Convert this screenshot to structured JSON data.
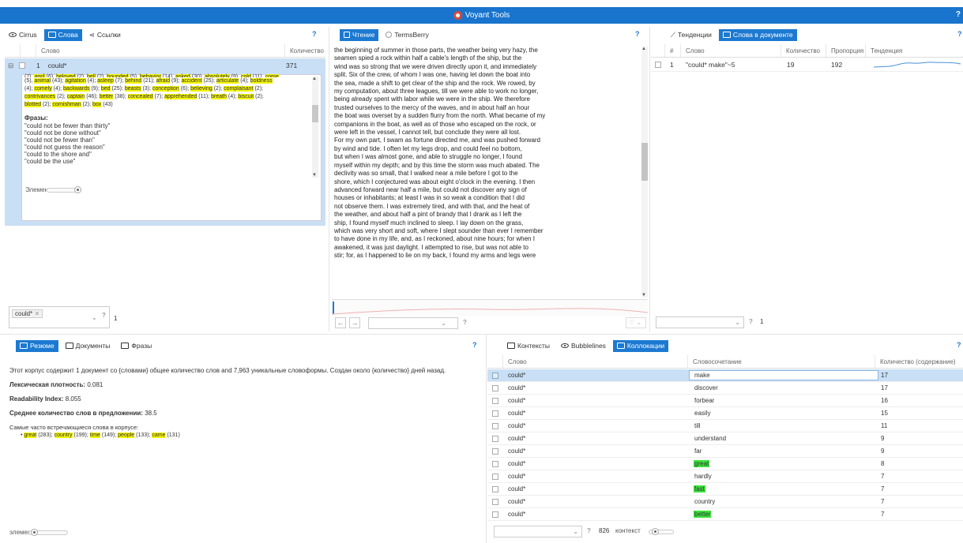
{
  "app": {
    "title": "Voyant Tools",
    "help": "?"
  },
  "left_panel": {
    "tabs": [
      {
        "label": "Cirrus",
        "icon": "eye-icon"
      },
      {
        "label": "Слова",
        "icon": "grid-icon"
      },
      {
        "label": "Ссылки",
        "icon": "network-icon"
      }
    ],
    "columns": {
      "word": "Слово",
      "count": "Количество"
    },
    "row": {
      "index": "1",
      "word": "could*",
      "count": "371"
    },
    "phrases_title": "Фразы:",
    "phrases": [
      "\"could not be fewer than thirty\"",
      "\"could not be done without\"",
      "\"could not be fewer than\"",
      "\"could not guess the reason\"",
      "\"could to the shore and\"",
      "\"could be the use\""
    ],
    "elements_label": "Элемен",
    "query_chip": "could*",
    "results_count": "1"
  },
  "reader_panel": {
    "tabs": [
      {
        "label": "Чтение",
        "icon": "document-icon"
      },
      {
        "label": "TermsBerry",
        "icon": "radio-icon"
      }
    ],
    "lines": [
      "the beginning of summer in those parts, the weather being very hazy, the",
      "seamen spied a rock within half a cable's length of the ship, but the",
      "wind was so strong that we were driven directly upon it, and immediately",
      "split. Six of the crew, of whom I was one, having let down the boat into",
      "the sea, made a shift to get clear of the ship and the rock. We rowed, by",
      "my computation, about three leagues, till we were able to work no longer,",
      "being already spent with labor while we were in the ship. We therefore",
      "trusted ourselves to the mercy of the waves, and in about half an hour",
      "the boat was overset by a sudden flurry from the north. What became of my",
      "companions in the boat, as well as of those who escaped on the rock, or",
      "were left in the vessel, I cannot tell, but conclude they were all lost.",
      "For my own part, I swam as fortune directed me, and was pushed forward",
      "by wind and tide. I often let my legs drop, and could feel no bottom,",
      "but when I was almost gone, and able to struggle no longer, I found",
      "myself within my depth; and by this time the storm was much abated. The",
      "declivity was so small, that I walked near a mile before I got to the",
      "shore, which I conjectured was about eight o'clock in the evening. I then",
      "advanced forward near half a mile, but could not discover any sign of",
      "houses or inhabitants; at least I was in so weak a condition that I did",
      "not observe them. I was extremely tired, and with that, and the heat of",
      "the weather, and about half a pint of brandy that I drank as I left the",
      "ship, I found myself much inclined to sleep. I lay down on the grass,",
      "which was very short and soft, where I slept sounder than ever I remember",
      "to have done in my life, and, as I reckoned, about nine hours; for when I",
      "awakened, it was just daylight. I attempted to rise, but was not able to",
      "stir; for, as I happened to lie on my back, I found my arms and legs were"
    ]
  },
  "trends_panel": {
    "tabs": [
      {
        "label": "Тенденции",
        "icon": "line-chart-icon"
      },
      {
        "label": "Слова в документе",
        "icon": "grid-icon"
      }
    ],
    "columns": {
      "num": "#",
      "word": "Слово",
      "count": "Количество",
      "ratio": "Пропорция",
      "trend": "Тенденция"
    },
    "row": {
      "num": "1",
      "word": "\"could* make\"~5",
      "count": "19",
      "ratio": "192"
    },
    "results_count": "1"
  },
  "summary_panel": {
    "tabs": [
      {
        "label": "Резюме",
        "icon": "grid-icon"
      },
      {
        "label": "Документы",
        "icon": "grid-icon"
      },
      {
        "label": "Фразы",
        "icon": "grid-icon"
      }
    ],
    "intro": "Этот корпус содержит 1 документ со {словами} общее количество слов and 7,963 уникальные словоформы. Создан около {количество} дней назад.",
    "density_label": "Лексическая плотность:",
    "density_value": "0.081",
    "readability_label": "Readability Index:",
    "readability_value": "8.055",
    "avg_label": "Среднее количество слов в предложении:",
    "avg_value": "38.5",
    "frequent_title": "Самые часто встречающиеся слова в корпусе:",
    "frequent": [
      {
        "word": "great",
        "count": "(283)"
      },
      {
        "word": "country",
        "count": "(199)"
      },
      {
        "word": "time",
        "count": "(149)"
      },
      {
        "word": "people",
        "count": "(133)"
      },
      {
        "word": "came",
        "count": "(131)"
      }
    ],
    "elements_label": "элемен"
  },
  "colloc_panel": {
    "tabs": [
      {
        "label": "Контексты",
        "icon": "grid-icon"
      },
      {
        "label": "Bubblelines",
        "icon": "eye-icon"
      },
      {
        "label": "Коллокации",
        "icon": "grid-icon"
      }
    ],
    "columns": {
      "word": "Слово",
      "collocate": "Словосочетание",
      "count": "Количество (содержание)"
    },
    "rows": [
      {
        "word": "could*",
        "collocate": "make",
        "count": "17",
        "hl": false,
        "selected": true
      },
      {
        "word": "could*",
        "collocate": "discover",
        "count": "17",
        "hl": false,
        "selected": false
      },
      {
        "word": "could*",
        "collocate": "forbear",
        "count": "16",
        "hl": false,
        "selected": false
      },
      {
        "word": "could*",
        "collocate": "easily",
        "count": "15",
        "hl": false,
        "selected": false
      },
      {
        "word": "could*",
        "collocate": "till",
        "count": "11",
        "hl": false,
        "selected": false
      },
      {
        "word": "could*",
        "collocate": "understand",
        "count": "9",
        "hl": false,
        "selected": false
      },
      {
        "word": "could*",
        "collocate": "far",
        "count": "9",
        "hl": false,
        "selected": false
      },
      {
        "word": "could*",
        "collocate": "great",
        "count": "8",
        "hl": true,
        "selected": false
      },
      {
        "word": "could*",
        "collocate": "hardly",
        "count": "7",
        "hl": false,
        "selected": false
      },
      {
        "word": "could*",
        "collocate": "fast",
        "count": "7",
        "hl": true,
        "selected": false
      },
      {
        "word": "could*",
        "collocate": "country",
        "count": "7",
        "hl": false,
        "selected": false
      },
      {
        "word": "could*",
        "collocate": "better",
        "count": "7",
        "hl": true,
        "selected": false
      }
    ],
    "results_count": "826",
    "context_label": "контекст"
  }
}
